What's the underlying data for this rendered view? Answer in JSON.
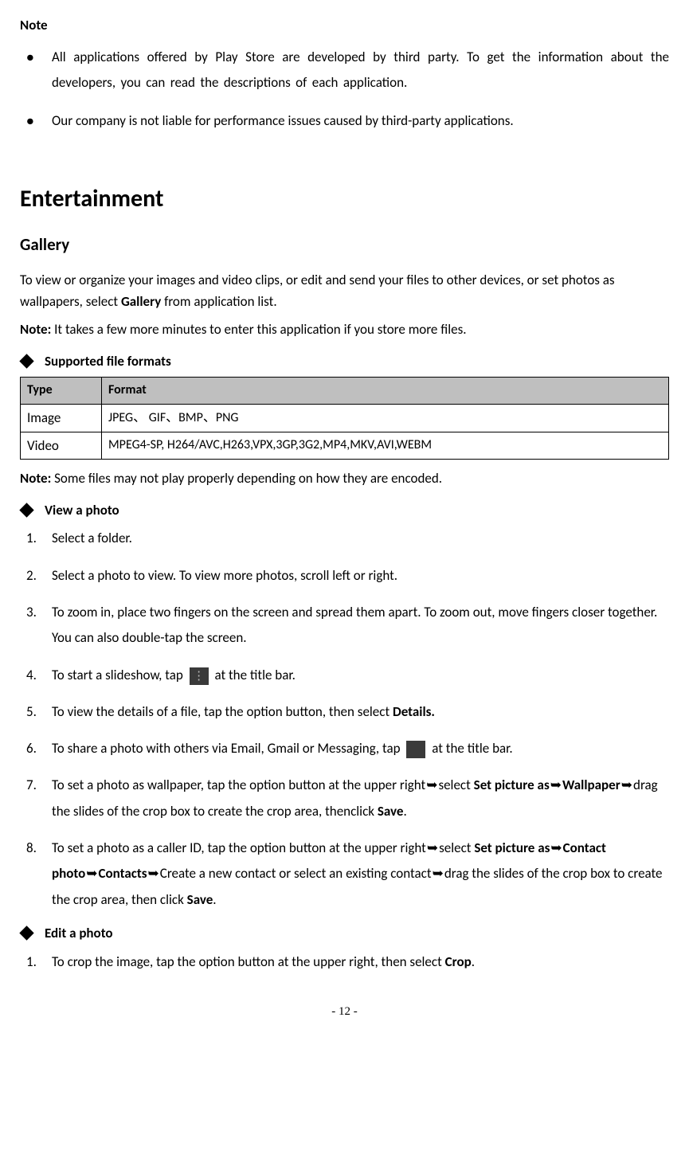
{
  "note_heading": "Note",
  "note_bullets": [
    "All applications offered by Play Store are developed by third party. To get the information about the developers, you can read the descriptions of each application.",
    "Our company is not liable for performance issues caused by third-party applications."
  ],
  "section_title": "Entertainment",
  "gallery_heading": "Gallery",
  "gallery_intro_pre": "To view or organize your images and video clips, or edit and send your files to other devices, or set photos as wallpapers, select ",
  "gallery_intro_bold": "Gallery",
  "gallery_intro_post": " from application list.",
  "gallery_note_label": "Note:",
  "gallery_note_text": " It takes a few more minutes to enter this application if you store more files.",
  "supported_heading": "Supported file formats",
  "table": {
    "th_type": "Type",
    "th_format": "Format",
    "rows": [
      {
        "type": "Image",
        "format": "JPEG、 GIF、BMP、PNG"
      },
      {
        "type": "Video",
        "format": "MPEG4-SP, H264/AVC,H263,VPX,3GP,3G2,MP4,MKV,AVI,WEBM"
      }
    ]
  },
  "table_note_label": "Note:",
  "table_note_text": " Some files may not play properly depending on how they are encoded.",
  "view_photo_heading": "View a photo",
  "steps": {
    "s1": "Select a folder.",
    "s2": "Select a photo to view. To view more photos, scroll left or right.",
    "s3": "To zoom in, place two fingers on the screen and spread them apart. To zoom out, move fingers closer together. You can also double-tap the screen.",
    "s4_pre": "To start a slideshow, tap ",
    "s4_post": " at the title bar.",
    "s5_pre": "To view the details of a file, tap the option button, then select ",
    "s5_bold": "Details.",
    "s6_pre": "To share a photo with others via Email, Gmail or Messaging, tap ",
    "s6_post": " at the title bar.",
    "s7_a": "To set a photo as wallpaper, tap the option button at the upper right",
    "s7_b": "select ",
    "s7_b_bold": "Set picture as",
    "s7_c_bold": "Wallpaper",
    "s7_d": "drag the slides of the crop box to create the crop area, thenclick ",
    "s7_d_bold": "Save",
    "s7_e": ".",
    "s8_a": "To set a photo as a caller ID, tap the option button at the upper right",
    "s8_b": "select ",
    "s8_b_bold": "Set picture as",
    "s8_c_bold": "Contact photo",
    "s8_d_bold": "Contacts",
    "s8_e": "Create a new contact or select an existing contact",
    "s8_f": "drag the slides of the crop box to create the crop area, then click ",
    "s8_f_bold": "Save",
    "s8_g": "."
  },
  "edit_photo_heading": "Edit a photo",
  "edit_steps": {
    "e1_pre": "To crop the image, tap the option button at the upper right, then select ",
    "e1_bold": "Crop",
    "e1_post": "."
  },
  "page_number": "- 12 -",
  "arrow": "➥"
}
